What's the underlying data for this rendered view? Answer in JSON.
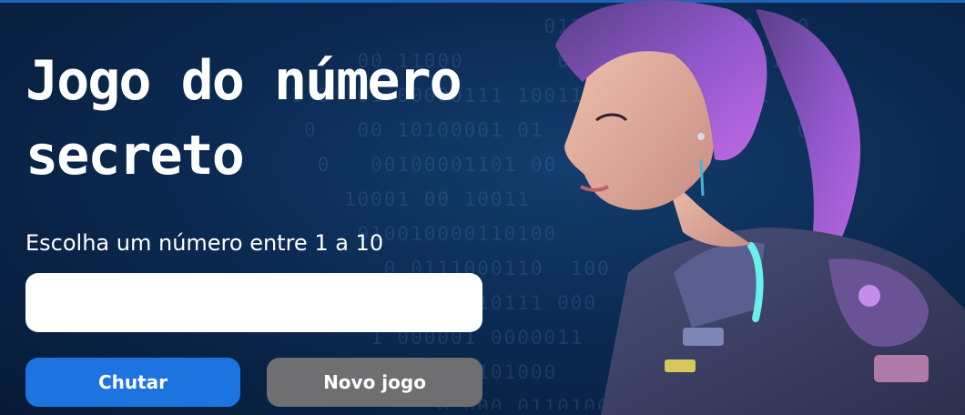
{
  "page": {
    "title": "Jogo do número secreto",
    "prompt": "Escolha um número entre 1 a 10",
    "input_value": "",
    "buttons": {
      "guess_label": "Chutar",
      "new_game_label": "Novo jogo"
    }
  },
  "background": {
    "binary_lines": [
      "                     0110100001011011 1 0",
      "       00 11000       0001011  0 10110100",
      "  1 0  01 00000111 10011      10000011  1",
      "   0   00 10100001 01                   0",
      "    0   00100001101 00",
      "      10001 00 10011",
      "       010010000110100",
      "         0 0111000110  100",
      "           1000010111 000",
      "        1 000001 0000011",
      "   0  0       01101000",
      "             0 000 0110100",
      "                       1011011"
    ]
  },
  "colors": {
    "guess_button": "#1d74e0",
    "new_game_button": "#6f6f72",
    "background": "#0b2a52"
  }
}
